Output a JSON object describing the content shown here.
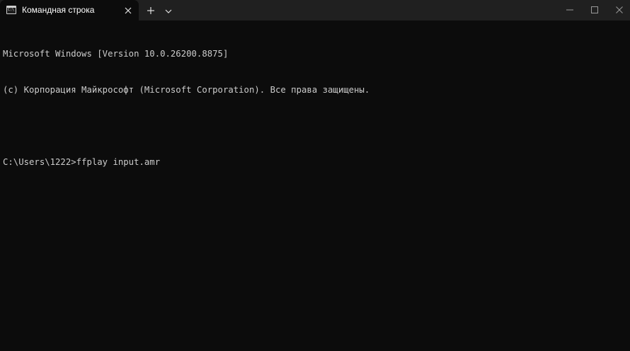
{
  "window": {
    "tab_title": "Командная строка"
  },
  "icons": {
    "tab_icon": "cmd-prompt-icon",
    "close_tab": "close-icon",
    "new_tab": "plus-icon",
    "dropdown": "chevron-down-icon",
    "minimize": "minimize-icon",
    "maximize": "maximize-icon",
    "close_window": "close-icon"
  },
  "colors": {
    "background": "#0c0c0c",
    "titlebar": "#202020",
    "text": "#cccccc"
  },
  "terminal": {
    "lines": [
      "Microsoft Windows [Version 10.0.26200.8875]",
      "(c) Корпорация Майкрософт (Microsoft Corporation). Все права защищены.",
      "",
      "C:\\Users\\1222>ffplay input.amr"
    ]
  }
}
